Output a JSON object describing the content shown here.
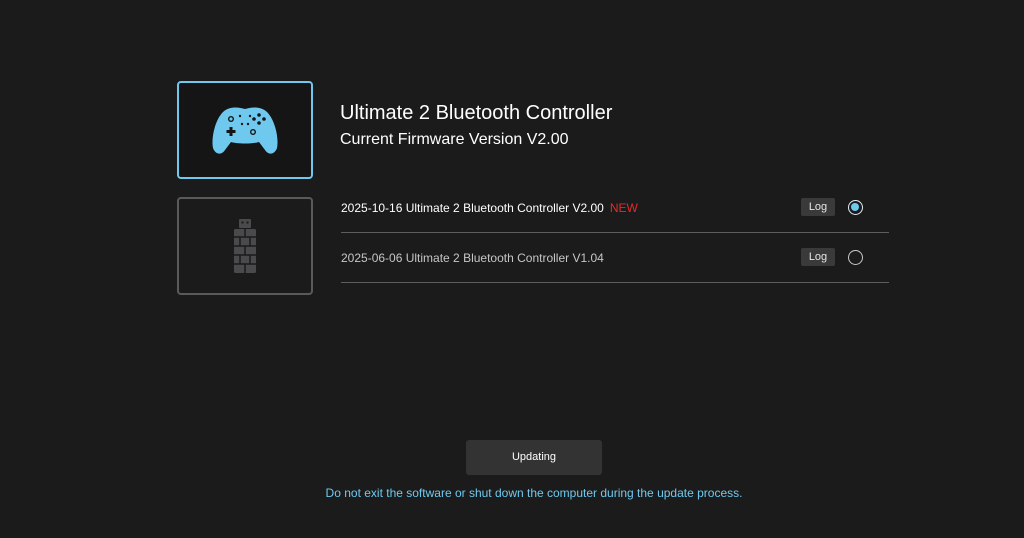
{
  "device": {
    "name": "Ultimate 2 Bluetooth Controller",
    "firmware_current": "Current Firmware Version V2.00"
  },
  "devices": [
    {
      "icon": "gamepad-icon",
      "selected": true
    },
    {
      "icon": "usb-dongle-icon",
      "selected": false
    }
  ],
  "firmware_list": [
    {
      "label": "2025-10-16 Ultimate 2 Bluetooth Controller V2.00",
      "badge": "NEW",
      "log_label": "Log",
      "selected": true
    },
    {
      "label": "2025-06-06 Ultimate 2 Bluetooth Controller V1.04",
      "badge": "",
      "log_label": "Log",
      "selected": false
    }
  ],
  "action": {
    "button_label": "Updating",
    "warning": "Do not exit the software or shut down the computer during the update process."
  },
  "colors": {
    "accent": "#6fc9ee",
    "new_badge": "#e52a2a",
    "background": "#1b1b1c"
  }
}
